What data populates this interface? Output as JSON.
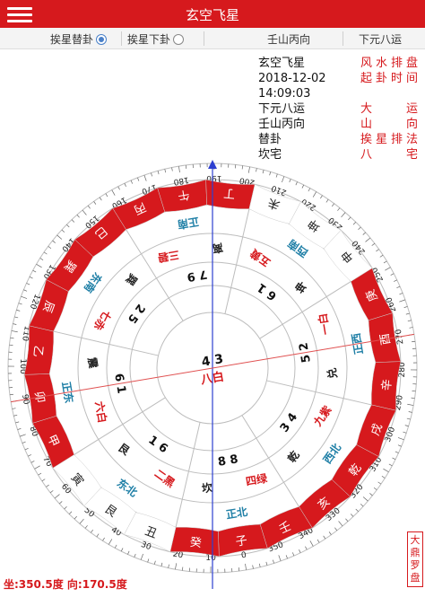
{
  "header": {
    "title": "玄空飞星"
  },
  "options": {
    "items": [
      {
        "label": "挨星替卦",
        "selected": true
      },
      {
        "label": "挨星下卦",
        "selected": false
      },
      {
        "label": "壬山丙向",
        "selected": false
      },
      {
        "label": "下元八运",
        "selected": false
      }
    ]
  },
  "info": {
    "rows": [
      {
        "label": "风水排盘",
        "value": "玄空飞星"
      },
      {
        "label": "起卦时间",
        "value": "2018-12-02 14:09:03"
      },
      {
        "label": "大运",
        "value": "下元八运"
      },
      {
        "label": "山向",
        "value": "壬山丙向"
      },
      {
        "label": "挨星排法",
        "value": "替卦"
      },
      {
        "label": "八宅",
        "value": "坎宅"
      }
    ]
  },
  "status": {
    "text": "坐:350.5度 向:170.5度"
  },
  "stamp": {
    "text": "大鼎罗盘"
  },
  "compass": {
    "red": "#d6191d",
    "teal": "#1f7fa6",
    "mountains": [
      "子",
      "癸",
      "丑",
      "艮",
      "寅",
      "甲",
      "卯",
      "乙",
      "辰",
      "巽",
      "巳",
      "丙",
      "午",
      "丁",
      "未",
      "坤",
      "申",
      "庚",
      "酉",
      "辛",
      "戌",
      "乾",
      "亥",
      "壬"
    ],
    "highlighted": [
      "壬",
      "子",
      "癸",
      "丙",
      "午",
      "丁",
      "甲",
      "卯",
      "乙",
      "庚",
      "酉",
      "辛",
      "乾",
      "戌",
      "亥",
      "辰",
      "巽",
      "巳"
    ],
    "degree_labels": [
      "0",
      "10",
      "20",
      "30",
      "40",
      "50",
      "60",
      "70",
      "80",
      "90",
      "100",
      "110",
      "120",
      "130",
      "140",
      "150",
      "160",
      "170",
      "180",
      "190",
      "200",
      "210",
      "220",
      "230",
      "240",
      "250",
      "260",
      "270",
      "280",
      "290",
      "300",
      "310",
      "320",
      "330",
      "340",
      "350"
    ],
    "palaces": {
      "北": {
        "gua": "坎",
        "name": "正北",
        "ring": "四绿",
        "stars": "8 8"
      },
      "东北": {
        "gua": "艮",
        "name": "东北",
        "ring": "二黑",
        "stars": "1 6"
      },
      "东": {
        "gua": "震",
        "name": "正东",
        "ring": "六白",
        "stars": "6 1"
      },
      "东南": {
        "gua": "巽",
        "name": "东南",
        "ring": "七赤",
        "stars": "2 5"
      },
      "南": {
        "gua": "离",
        "name": "正南",
        "ring": "三碧",
        "stars": "7 9"
      },
      "西南": {
        "gua": "坤",
        "name": "西南",
        "ring": "五黄",
        "stars": "6 1"
      },
      "西": {
        "gua": "兑",
        "name": "正西",
        "ring": "一白",
        "stars": "5 2"
      },
      "西北": {
        "gua": "乾",
        "name": "西北",
        "ring": "九紫",
        "stars": "3 4"
      }
    },
    "center": {
      "stars": "4 3",
      "ring": "八白"
    }
  }
}
